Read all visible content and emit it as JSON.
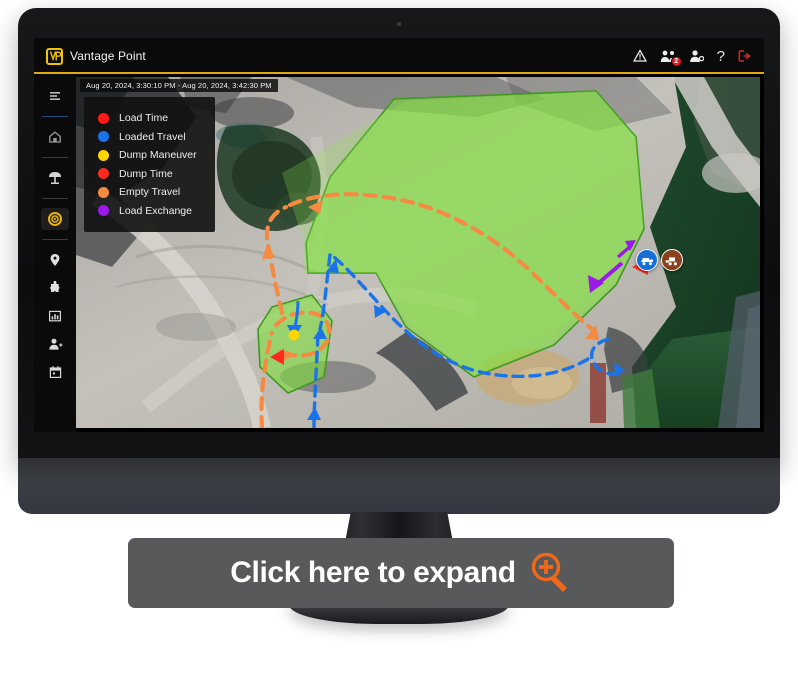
{
  "header": {
    "brand_name": "Vantage Point",
    "brand_mark_icon": "vp-monogram-icon",
    "accent_color": "#e0a80d",
    "actions": [
      {
        "icon": "warning-triangle-icon",
        "label": "Alerts"
      },
      {
        "icon": "notifications-user-icon",
        "label": "Notifications",
        "badge": "2"
      },
      {
        "icon": "user-settings-icon",
        "label": "User Settings"
      },
      {
        "icon": "help-question-icon",
        "label": "Help",
        "glyph": "?"
      },
      {
        "icon": "logout-icon",
        "label": "Log Out",
        "color": "#d62b2b"
      }
    ]
  },
  "sidebar": {
    "items": [
      {
        "icon": "hamburger-menu-icon",
        "label": "Menu",
        "active": false
      },
      {
        "icon": "home-icon",
        "label": "Home",
        "active": false
      },
      {
        "icon": "mine-site-icon",
        "label": "Site",
        "active": false
      },
      {
        "icon": "target-cycle-icon",
        "label": "Cycle Analysis",
        "active": true
      },
      {
        "icon": "map-pin-icon",
        "label": "Locations",
        "active": false
      },
      {
        "icon": "puzzle-piece-icon",
        "label": "Integrations",
        "active": false
      },
      {
        "icon": "bar-chart-icon",
        "label": "Reports",
        "active": false
      },
      {
        "icon": "user-add-icon",
        "label": "Operators",
        "active": false
      },
      {
        "icon": "calendar-icon",
        "label": "Schedule",
        "active": false
      }
    ]
  },
  "map": {
    "timestamp_range": "Aug 20, 2024, 3:30:10 PM - Aug 20, 2024, 3:42:30 PM",
    "legend": [
      {
        "label": "Load Time",
        "color": "#ff1a16"
      },
      {
        "label": "Loaded Travel",
        "color": "#1a73e8"
      },
      {
        "label": "Dump Maneuver",
        "color": "#ffd400"
      },
      {
        "label": "Dump Time",
        "color": "#ff2a1e"
      },
      {
        "label": "Empty Travel",
        "color": "#f58a42"
      },
      {
        "label": "Load Exchange",
        "color": "#9b1ae8"
      }
    ],
    "markers": [
      {
        "icon": "haul-truck-icon",
        "label": "Haul Truck",
        "color": "#1470d8"
      },
      {
        "icon": "loader-icon",
        "label": "Loader",
        "color": "#8a3f1d"
      }
    ],
    "zones": [
      {
        "name": "load-zone-polygon",
        "fill": "#7ee03a"
      },
      {
        "name": "dump-zone-polygon",
        "fill": "#7ee03a"
      }
    ]
  },
  "expand": {
    "label": "Click here to expand",
    "icon": "magnifier-plus-icon",
    "icon_color": "#f0691a"
  }
}
